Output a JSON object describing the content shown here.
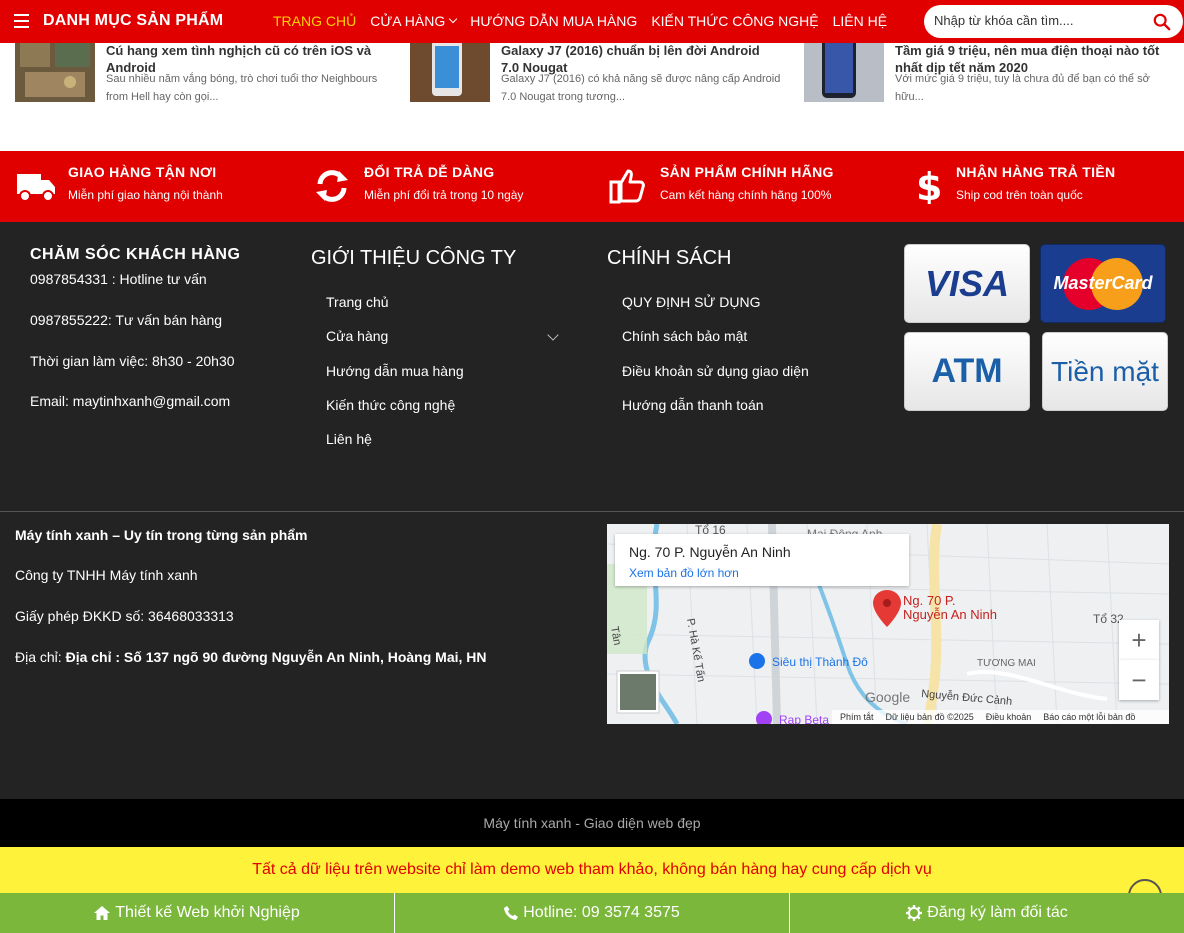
{
  "header": {
    "category_title": "DANH MỤC SẢN PHẨM",
    "nav": [
      {
        "label": "TRANG CHỦ",
        "active": true
      },
      {
        "label": "CỬA HÀNG",
        "has_caret": true
      },
      {
        "label": "HƯỚNG DẪN MUA HÀNG"
      },
      {
        "label": "KIẾN THỨC CÔNG NGHỆ"
      },
      {
        "label": "LIÊN HỆ"
      }
    ],
    "search_placeholder": "Nhập từ khóa cần tìm....",
    "brand_color": "#e00000",
    "active_color": "#ffd200"
  },
  "news": [
    {
      "title": "Cú hang xem tình nghịch cũ có trên iOS và Android",
      "desc": "Sau nhiều năm vắng bóng, trò chơi tuổi thơ Neighbours from Hell hay còn gọi..."
    },
    {
      "title": "Galaxy J7 (2016) chuẩn bị lên đời Android 7.0 Nougat",
      "desc": "Galaxy J7 (2016) có khả năng sẽ được nâng cấp Android 7.0 Nougat trong tương..."
    },
    {
      "title": "Tầm giá 9 triệu, nên mua điện thoại nào tốt nhất dịp tết năm 2020",
      "desc": "Với mức giá 9 triệu, tuy là chưa đủ để bạn có thể sở hữu..."
    }
  ],
  "services": [
    {
      "icon": "truck-icon",
      "title": "GIAO HÀNG TẬN NƠI",
      "sub": "Miễn phí giao hàng nội thành"
    },
    {
      "icon": "refresh-icon",
      "title": "ĐỔI TRẢ DỄ DÀNG",
      "sub": "Miễn phí đổi trả trong 10 ngày"
    },
    {
      "icon": "thumbs-up-icon",
      "title": "SẢN PHẨM CHÍNH HÃNG",
      "sub": "Cam kết hàng chính hãng 100%"
    },
    {
      "icon": "dollar-icon",
      "title": "NHẬN HÀNG TRẢ TIỀN",
      "sub": "Ship cod trên toàn quốc"
    }
  ],
  "footer": {
    "care": {
      "title": "CHĂM SÓC KHÁCH HÀNG",
      "lines": [
        "0987854331 : Hotline tư vấn",
        "0987855222: Tư vấn bán hàng",
        "Thời gian làm việc: 8h30 - 20h30",
        "Email: maytinhxanh@gmail.com"
      ]
    },
    "company": {
      "title": "GIỚI THIỆU CÔNG TY",
      "items": [
        "Trang chủ",
        "Cửa hàng",
        "Hướng dẫn mua hàng",
        "Kiến thức công nghệ",
        "Liên hệ"
      ]
    },
    "policy": {
      "title": "CHÍNH SÁCH",
      "items": [
        "QUY ĐỊNH SỬ DỤNG",
        "Chính sách bảo mật",
        "Điều khoản sử dụng giao diện",
        "Hướng dẫn thanh toán"
      ]
    },
    "payments": [
      "VISA",
      "MasterCard",
      "ATM",
      "Tiền mặt"
    ],
    "info": {
      "slogan": "Máy tính xanh – Uy tín trong từng sản phẩm",
      "company": "Công ty TNHH Máy tính xanh",
      "license": "Giấy phép ĐKKD số: 36468033313",
      "address_label": "Địa chỉ: ",
      "address": "Địa chỉ : Số 137 ngõ 90 đường Nguyễn An Ninh, Hoàng Mai, HN"
    },
    "map": {
      "card_title": "Ng. 70 P. Nguyễn An Ninh",
      "card_link": "Xem bản đồ lớn hơn",
      "pin_label": "Ng. 70 P. Nguyễn An Ninh",
      "labels": [
        "Siêu thị Thành Đô",
        "TƯƠNG MAI",
        "Nguyễn Đức Cảnh",
        "Tổ 16",
        "Tổ 32",
        "P. Hà Kế Tấn",
        "Mai Động Anh",
        "Rạp Beta",
        "Tân"
      ],
      "footer": [
        "Phím tắt",
        "Dữ liệu bản đồ ©2025",
        "Điều khoản",
        "Báo cáo một lỗi bản đồ"
      ],
      "google": "Google",
      "zoom_in": "+",
      "zoom_out": "−"
    }
  },
  "copyright": "Máy tính xanh - Giao diện web đẹp",
  "notice": "Tất cả dữ liệu trên website chỉ làm demo web tham khảo, không bán hàng hay cung cấp dịch vụ",
  "cta": [
    {
      "icon": "home-icon",
      "label": "Thiết kế Web khởi Nghiệp"
    },
    {
      "icon": "phone-icon",
      "label": "Hotline: 09 3574 3575"
    },
    {
      "icon": "gear-icon",
      "label": "Đăng ký làm đối tác"
    }
  ]
}
